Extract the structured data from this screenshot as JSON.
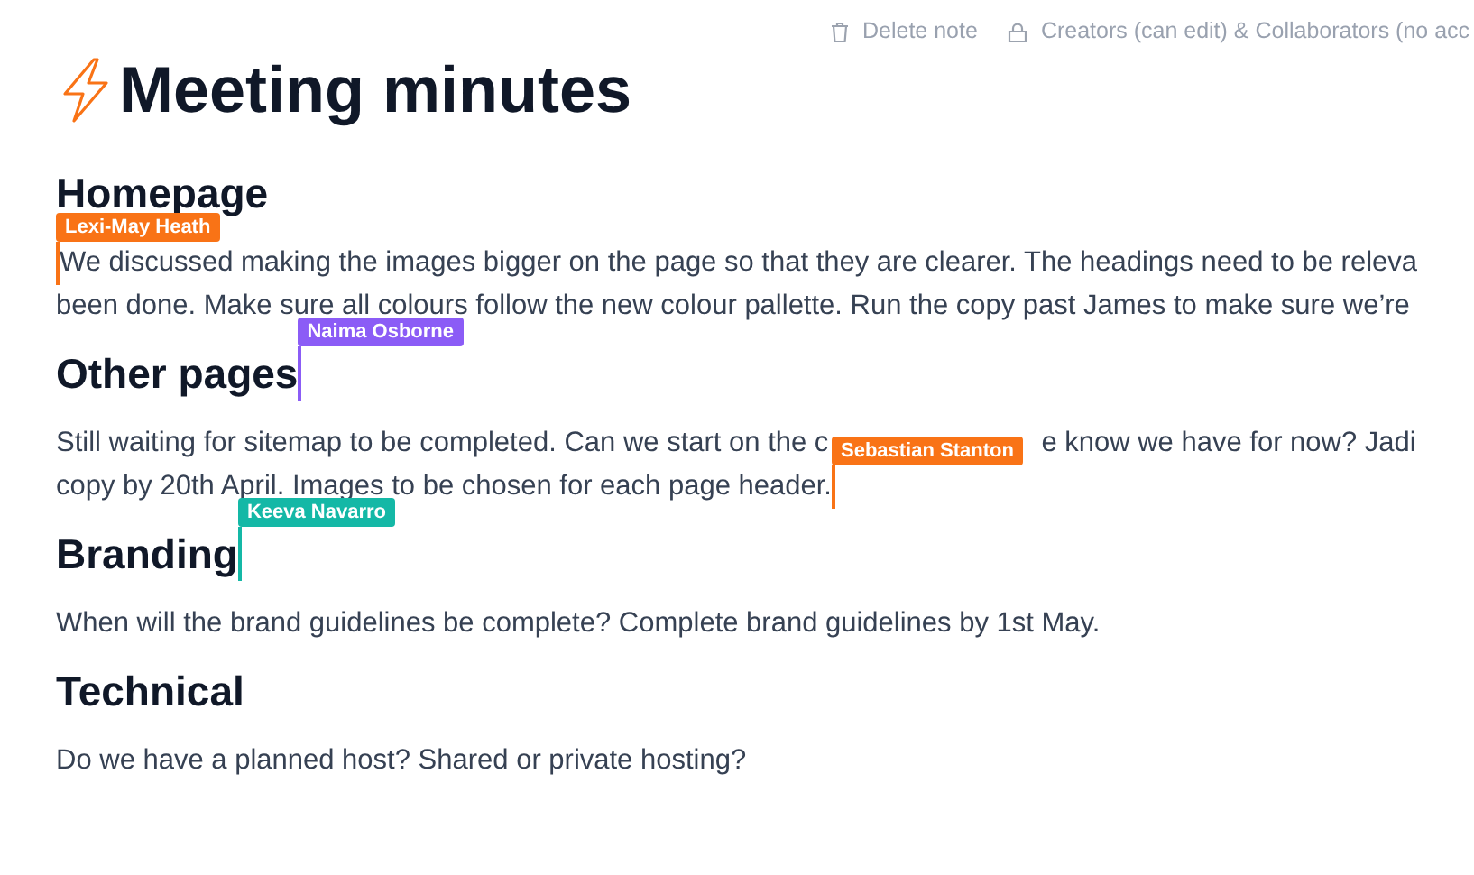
{
  "toolbar": [
    {
      "kind": "trash",
      "label": "Delete note"
    },
    {
      "kind": "lock",
      "label": "Creators (can edit) & Collaborators (no acc"
    }
  ],
  "title": "Meeting minutes",
  "blocks": [
    {
      "kind": "heading",
      "segments": [
        {
          "kind": "text",
          "text": "Homepage"
        }
      ]
    },
    {
      "kind": "paragraph",
      "lines": [
        [
          {
            "kind": "cursor",
            "name": "Lexi-May Heath",
            "color": "#f97316"
          },
          {
            "kind": "text",
            "text": "We discussed making the images bigger on the page so that they are clearer. The headings need to be releva"
          }
        ],
        [
          {
            "kind": "text",
            "text": "been done. Make sure all colours follow the new colour pallette. Run the copy past James to make sure we’re"
          }
        ]
      ]
    },
    {
      "kind": "heading",
      "segments": [
        {
          "kind": "text",
          "text": "Other pages"
        },
        {
          "kind": "cursor",
          "name": "Naima Osborne",
          "color": "#8b5cf6"
        }
      ]
    },
    {
      "kind": "paragraph",
      "lines": [
        [
          {
            "kind": "text",
            "text": "Still waiting for sitemap to be completed. Can we start on the c"
          },
          {
            "kind": "text",
            "text": "e know we have for now? Jadi"
          }
        ],
        [
          {
            "kind": "text",
            "text": "copy by 20th April. Images to be chosen for each page header."
          },
          {
            "kind": "cursor",
            "name": "Sebastian Stanton",
            "color": "#f97316"
          }
        ]
      ]
    },
    {
      "kind": "heading",
      "segments": [
        {
          "kind": "text",
          "text": "Branding"
        },
        {
          "kind": "cursor",
          "name": "Keeva Navarro",
          "color": "#14b8a6"
        }
      ]
    },
    {
      "kind": "paragraph",
      "lines": [
        [
          {
            "kind": "text",
            "text": "When will the brand guidelines be complete? Complete brand guidelines by 1st May."
          }
        ]
      ]
    },
    {
      "kind": "heading",
      "segments": [
        {
          "kind": "text",
          "text": "Technical"
        }
      ]
    },
    {
      "kind": "paragraph",
      "lines": [
        [
          {
            "kind": "text",
            "text": "Do we have a planned host? Shared or private hosting?"
          }
        ]
      ]
    }
  ]
}
